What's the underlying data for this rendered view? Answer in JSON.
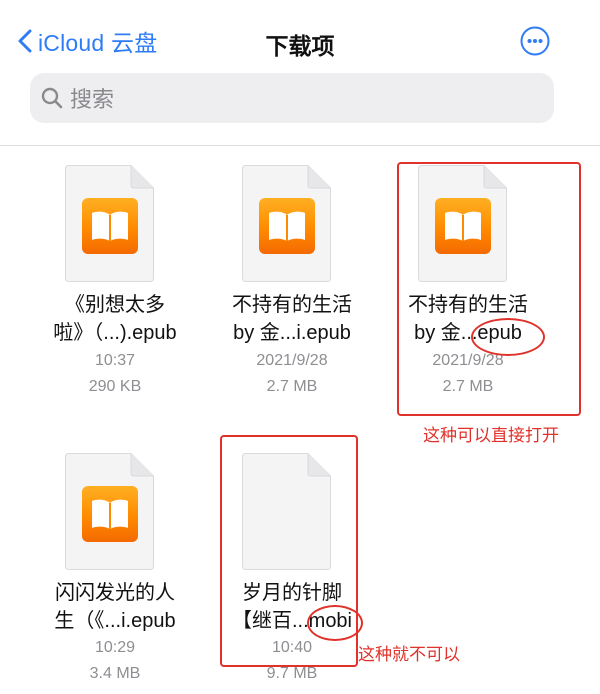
{
  "nav": {
    "back_label": "iCloud 云盘",
    "title": "下载项"
  },
  "search": {
    "placeholder": "搜索"
  },
  "files": [
    {
      "line1": "《别想太多",
      "line2": "啦》（...).epub",
      "time": "10:37",
      "size": "290 KB",
      "type": "book"
    },
    {
      "line1": "不持有的生活",
      "line2": "by 金...i.epub",
      "time": "2021/9/28",
      "size": "2.7 MB",
      "type": "book"
    },
    {
      "line1": "不持有的生活",
      "line2": "by 金...epub",
      "time": "2021/9/28",
      "size": "2.7 MB",
      "type": "book"
    },
    {
      "line1": "闪闪发光的人",
      "line2": "生（《...i.epub",
      "time": "10:29",
      "size": "3.4 MB",
      "type": "book"
    },
    {
      "line1": "岁月的针脚",
      "line2": "【继百...mobi",
      "time": "10:40",
      "size": "9.7 MB",
      "type": "blank"
    }
  ],
  "annotations": {
    "can_open": "这种可以直接打开",
    "cannot_open": "这种就不可以"
  },
  "colors": {
    "accent": "#2f7cf6",
    "annotation_red": "#e0322a",
    "book_orange": "#ff8a00"
  },
  "icons": [
    "chevron-left-icon",
    "more-icon",
    "search-icon",
    "document-icon",
    "books-icon"
  ]
}
